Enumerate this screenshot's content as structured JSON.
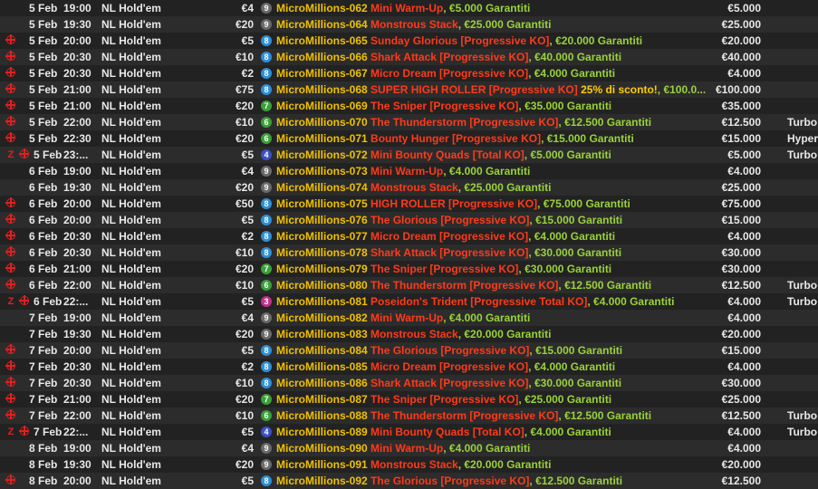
{
  "colors": {
    "series": "#f0c000",
    "event": "#ff3a1a",
    "guaranteed": "#9ad23a",
    "discount": "#ffcc00",
    "ko_icon": "#e02020",
    "badges": {
      "9": "#6a6a6a",
      "8": "#2d8fd8",
      "7": "#3aa038",
      "6": "#3aa038",
      "4": "#3b4fc4",
      "3": "#c0308a"
    }
  },
  "tournaments": [
    {
      "date": "5 Feb",
      "time": "19:00",
      "game": "NL Hold'em",
      "buyin": "€4",
      "badge": "9",
      "id": "MicroMillions-062",
      "event": "Mini Warm-Up",
      "gtd": ", €5.000 Garantiti",
      "discount": "",
      "prize": "€5.000",
      "tag": "",
      "ko": false,
      "zoom": false
    },
    {
      "date": "5 Feb",
      "time": "19:30",
      "game": "NL Hold'em",
      "buyin": "€20",
      "badge": "9",
      "id": "MicroMillions-064",
      "event": "Monstrous Stack",
      "gtd": ", €25.000 Garantiti",
      "discount": "",
      "prize": "€25.000",
      "tag": "",
      "ko": false,
      "zoom": false
    },
    {
      "date": "5 Feb",
      "time": "20:00",
      "game": "NL Hold'em",
      "buyin": "€5",
      "badge": "8",
      "id": "MicroMillions-065",
      "event": "Sunday Glorious [Progressive KO]",
      "gtd": ", €20.000 Garantiti",
      "discount": "",
      "prize": "€20.000",
      "tag": "",
      "ko": true,
      "zoom": false
    },
    {
      "date": "5 Feb",
      "time": "20:30",
      "game": "NL Hold'em",
      "buyin": "€10",
      "badge": "8",
      "id": "MicroMillions-066",
      "event": "Shark Attack [Progressive KO]",
      "gtd": ", €40.000 Garantiti",
      "discount": "",
      "prize": "€40.000",
      "tag": "",
      "ko": true,
      "zoom": false
    },
    {
      "date": "5 Feb",
      "time": "20:30",
      "game": "NL Hold'em",
      "buyin": "€2",
      "badge": "8",
      "id": "MicroMillions-067",
      "event": "Micro Dream [Progressive KO]",
      "gtd": ", €4.000 Garantiti",
      "discount": "",
      "prize": "€4.000",
      "tag": "",
      "ko": true,
      "zoom": false
    },
    {
      "date": "5 Feb",
      "time": "21:00",
      "game": "NL Hold'em",
      "buyin": "€75",
      "badge": "8",
      "id": "MicroMillions-068",
      "event": "SUPER HIGH ROLLER [Progressive KO]",
      "gtd": ", €100.0...",
      "discount": "25% di sconto!",
      "prize": "€100.000",
      "tag": "",
      "ko": true,
      "zoom": false
    },
    {
      "date": "5 Feb",
      "time": "21:00",
      "game": "NL Hold'em",
      "buyin": "€20",
      "badge": "7",
      "id": "MicroMillions-069",
      "event": "The Sniper [Progressive KO]",
      "gtd": ", €35.000 Garantiti",
      "discount": "",
      "prize": "€35.000",
      "tag": "",
      "ko": true,
      "zoom": false
    },
    {
      "date": "5 Feb",
      "time": "22:00",
      "game": "NL Hold'em",
      "buyin": "€10",
      "badge": "6",
      "id": "MicroMillions-070",
      "event": "The Thunderstorm [Progressive KO]",
      "gtd": ", €12.500 Garantiti",
      "discount": "",
      "prize": "€12.500",
      "tag": "Turbo",
      "ko": true,
      "zoom": false
    },
    {
      "date": "5 Feb",
      "time": "22:30",
      "game": "NL Hold'em",
      "buyin": "€20",
      "badge": "6",
      "id": "MicroMillions-071",
      "event": "Bounty Hunger [Progressive KO]",
      "gtd": ", €15.000 Garantiti",
      "discount": "",
      "prize": "€15.000",
      "tag": "Hyper",
      "ko": true,
      "zoom": false
    },
    {
      "date": "5 Feb",
      "time": "23:...",
      "game": "NL Hold'em",
      "buyin": "€5",
      "badge": "4",
      "id": "MicroMillions-072",
      "event": "Mini Bounty Quads [Total KO]",
      "gtd": ", €5.000 Garantiti",
      "discount": "",
      "prize": "€5.000",
      "tag": "Turbo",
      "ko": true,
      "zoom": true
    },
    {
      "date": "6 Feb",
      "time": "19:00",
      "game": "NL Hold'em",
      "buyin": "€4",
      "badge": "9",
      "id": "MicroMillions-073",
      "event": "Mini Warm-Up",
      "gtd": ", €4.000 Garantiti",
      "discount": "",
      "prize": "€4.000",
      "tag": "",
      "ko": false,
      "zoom": false
    },
    {
      "date": "6 Feb",
      "time": "19:30",
      "game": "NL Hold'em",
      "buyin": "€20",
      "badge": "9",
      "id": "MicroMillions-074",
      "event": "Monstrous Stack",
      "gtd": ", €25.000 Garantiti",
      "discount": "",
      "prize": "€25.000",
      "tag": "",
      "ko": false,
      "zoom": false
    },
    {
      "date": "6 Feb",
      "time": "20:00",
      "game": "NL Hold'em",
      "buyin": "€50",
      "badge": "8",
      "id": "MicroMillions-075",
      "event": "HIGH ROLLER [Progressive KO]",
      "gtd": ", €75.000 Garantiti",
      "discount": "",
      "prize": "€75.000",
      "tag": "",
      "ko": true,
      "zoom": false
    },
    {
      "date": "6 Feb",
      "time": "20:00",
      "game": "NL Hold'em",
      "buyin": "€5",
      "badge": "8",
      "id": "MicroMillions-076",
      "event": "The Glorious [Progressive KO]",
      "gtd": ", €15.000 Garantiti",
      "discount": "",
      "prize": "€15.000",
      "tag": "",
      "ko": true,
      "zoom": false
    },
    {
      "date": "6 Feb",
      "time": "20:30",
      "game": "NL Hold'em",
      "buyin": "€2",
      "badge": "8",
      "id": "MicroMillions-077",
      "event": "Micro Dream [Progressive KO]",
      "gtd": ", €4.000 Garantiti",
      "discount": "",
      "prize": "€4.000",
      "tag": "",
      "ko": true,
      "zoom": false
    },
    {
      "date": "6 Feb",
      "time": "20:30",
      "game": "NL Hold'em",
      "buyin": "€10",
      "badge": "8",
      "id": "MicroMillions-078",
      "event": "Shark Attack [Progressive KO]",
      "gtd": ", €30.000 Garantiti",
      "discount": "",
      "prize": "€30.000",
      "tag": "",
      "ko": true,
      "zoom": false
    },
    {
      "date": "6 Feb",
      "time": "21:00",
      "game": "NL Hold'em",
      "buyin": "€20",
      "badge": "7",
      "id": "MicroMillions-079",
      "event": "The Sniper [Progressive KO]",
      "gtd": ", €30.000 Garantiti",
      "discount": "",
      "prize": "€30.000",
      "tag": "",
      "ko": true,
      "zoom": false
    },
    {
      "date": "6 Feb",
      "time": "22:00",
      "game": "NL Hold'em",
      "buyin": "€10",
      "badge": "6",
      "id": "MicroMillions-080",
      "event": "The Thunderstorm [Progressive KO]",
      "gtd": ", €12.500 Garantiti",
      "discount": "",
      "prize": "€12.500",
      "tag": "Turbo",
      "ko": true,
      "zoom": false
    },
    {
      "date": "6 Feb",
      "time": "22:...",
      "game": "NL Hold'em",
      "buyin": "€5",
      "badge": "3",
      "id": "MicroMillions-081",
      "event": "Poseidon's Trident [Progressive Total KO]",
      "gtd": ", €4.000 Garantiti",
      "discount": "",
      "prize": "€4.000",
      "tag": "Turbo",
      "ko": true,
      "zoom": true
    },
    {
      "date": "7 Feb",
      "time": "19:00",
      "game": "NL Hold'em",
      "buyin": "€4",
      "badge": "9",
      "id": "MicroMillions-082",
      "event": "Mini Warm-Up",
      "gtd": ", €4.000 Garantiti",
      "discount": "",
      "prize": "€4.000",
      "tag": "",
      "ko": false,
      "zoom": false
    },
    {
      "date": "7 Feb",
      "time": "19:30",
      "game": "NL Hold'em",
      "buyin": "€20",
      "badge": "9",
      "id": "MicroMillions-083",
      "event": "Monstrous Stack",
      "gtd": ", €20.000 Garantiti",
      "discount": "",
      "prize": "€20.000",
      "tag": "",
      "ko": false,
      "zoom": false
    },
    {
      "date": "7 Feb",
      "time": "20:00",
      "game": "NL Hold'em",
      "buyin": "€5",
      "badge": "8",
      "id": "MicroMillions-084",
      "event": "The Glorious [Progressive KO]",
      "gtd": ", €15.000 Garantiti",
      "discount": "",
      "prize": "€15.000",
      "tag": "",
      "ko": true,
      "zoom": false
    },
    {
      "date": "7 Feb",
      "time": "20:30",
      "game": "NL Hold'em",
      "buyin": "€2",
      "badge": "8",
      "id": "MicroMillions-085",
      "event": "Micro Dream [Progressive KO]",
      "gtd": ", €4.000 Garantiti",
      "discount": "",
      "prize": "€4.000",
      "tag": "",
      "ko": true,
      "zoom": false
    },
    {
      "date": "7 Feb",
      "time": "20:30",
      "game": "NL Hold'em",
      "buyin": "€10",
      "badge": "8",
      "id": "MicroMillions-086",
      "event": "Shark Attack [Progressive KO]",
      "gtd": ", €30.000 Garantiti",
      "discount": "",
      "prize": "€30.000",
      "tag": "",
      "ko": true,
      "zoom": false
    },
    {
      "date": "7 Feb",
      "time": "21:00",
      "game": "NL Hold'em",
      "buyin": "€20",
      "badge": "7",
      "id": "MicroMillions-087",
      "event": "The Sniper [Progressive KO]",
      "gtd": ", €25.000 Garantiti",
      "discount": "",
      "prize": "€25.000",
      "tag": "",
      "ko": true,
      "zoom": false
    },
    {
      "date": "7 Feb",
      "time": "22:00",
      "game": "NL Hold'em",
      "buyin": "€10",
      "badge": "6",
      "id": "MicroMillions-088",
      "event": "The Thunderstorm [Progressive KO]",
      "gtd": ", €12.500 Garantiti",
      "discount": "",
      "prize": "€12.500",
      "tag": "Turbo",
      "ko": true,
      "zoom": false
    },
    {
      "date": "7 Feb",
      "time": "22:...",
      "game": "NL Hold'em",
      "buyin": "€5",
      "badge": "4",
      "id": "MicroMillions-089",
      "event": "Mini Bounty Quads [Total KO]",
      "gtd": ", €4.000 Garantiti",
      "discount": "",
      "prize": "€4.000",
      "tag": "Turbo",
      "ko": true,
      "zoom": true
    },
    {
      "date": "8 Feb",
      "time": "19:00",
      "game": "NL Hold'em",
      "buyin": "€4",
      "badge": "9",
      "id": "MicroMillions-090",
      "event": "Mini Warm-Up",
      "gtd": ", €4.000 Garantiti",
      "discount": "",
      "prize": "€4.000",
      "tag": "",
      "ko": false,
      "zoom": false
    },
    {
      "date": "8 Feb",
      "time": "19:30",
      "game": "NL Hold'em",
      "buyin": "€20",
      "badge": "9",
      "id": "MicroMillions-091",
      "event": "Monstrous Stack",
      "gtd": ", €20.000 Garantiti",
      "discount": "",
      "prize": "€20.000",
      "tag": "",
      "ko": false,
      "zoom": false
    },
    {
      "date": "8 Feb",
      "time": "20:00",
      "game": "NL Hold'em",
      "buyin": "€5",
      "badge": "8",
      "id": "MicroMillions-092",
      "event": "The Glorious [Progressive KO]",
      "gtd": ", €12.500 Garantiti",
      "discount": "",
      "prize": "€12.500",
      "tag": "",
      "ko": true,
      "zoom": false
    }
  ]
}
